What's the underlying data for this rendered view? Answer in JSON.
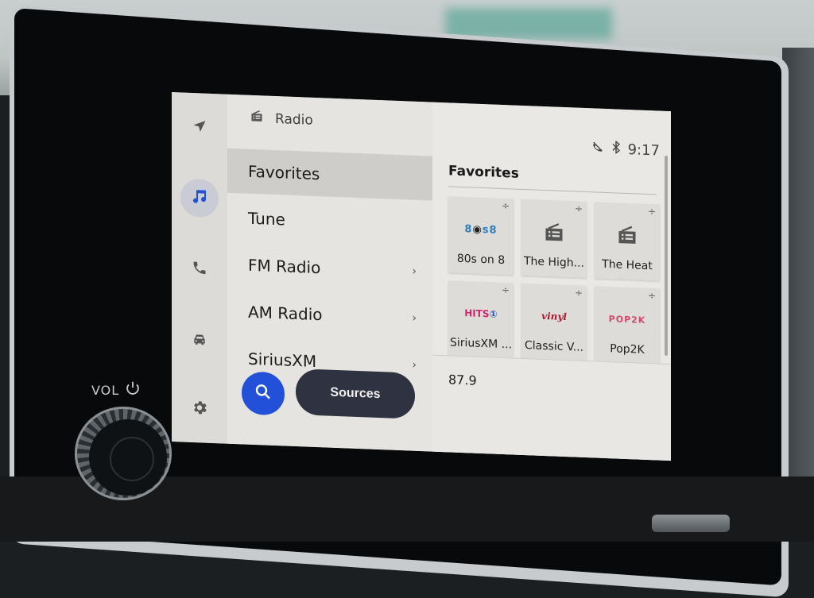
{
  "device": {
    "volume_label": "VOL",
    "icons": [
      "power-icon"
    ]
  },
  "rail": {
    "items": [
      {
        "name": "navigation",
        "icon": "navigation-arrow-icon",
        "active": false
      },
      {
        "name": "media",
        "icon": "music-note-icon",
        "active": true,
        "accent": "#2350d8"
      },
      {
        "name": "phone",
        "icon": "phone-icon",
        "active": false
      },
      {
        "name": "vehicle",
        "icon": "car-icon",
        "active": false
      },
      {
        "name": "settings",
        "icon": "gear-icon",
        "active": false
      }
    ]
  },
  "menu": {
    "title": "Radio",
    "title_icon": "radio-icon",
    "items": [
      {
        "label": "Favorites",
        "selected": true,
        "has_chevron": false
      },
      {
        "label": "Tune",
        "selected": false,
        "has_chevron": false
      },
      {
        "label": "FM Radio",
        "selected": false,
        "has_chevron": true
      },
      {
        "label": "AM Radio",
        "selected": false,
        "has_chevron": true
      },
      {
        "label": "SiriusXM",
        "selected": false,
        "has_chevron": true
      }
    ],
    "search_icon": "search-icon",
    "sources_label": "Sources"
  },
  "status": {
    "time": "9:17",
    "icons": [
      "phone-muted-icon",
      "bluetooth-icon"
    ]
  },
  "favorites": {
    "title": "Favorites",
    "tiles": [
      {
        "name": "80s on 8",
        "logo": "80s on 8 logo"
      },
      {
        "name": "The High...",
        "logo": "radio-icon"
      },
      {
        "name": "The Heat",
        "logo": "radio-icon"
      },
      {
        "name": "SiriusXM ...",
        "logo": "SiriusXM Hits 1 logo"
      },
      {
        "name": "Classic V...",
        "logo": "Classic Vinyl logo"
      },
      {
        "name": "Pop2K",
        "logo": "Pop2K logo"
      }
    ]
  },
  "now_playing": {
    "frequency": "87.9"
  },
  "colors": {
    "accent": "#2350d8",
    "sources_button": "#2f3240"
  }
}
